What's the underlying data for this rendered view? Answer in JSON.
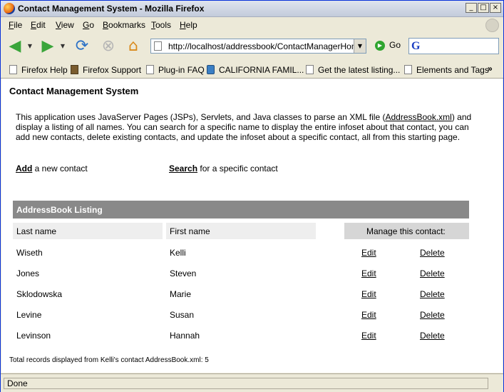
{
  "window": {
    "title": "Contact Management System - Mozilla Firefox",
    "min_label": "_",
    "max_label": "□",
    "close_label": "×"
  },
  "menu": [
    "File",
    "Edit",
    "View",
    "Go",
    "Bookmarks",
    "Tools",
    "Help"
  ],
  "nav": {
    "url": "http://localhost/addressbook/ContactManagerHome.js",
    "go_label": "Go",
    "search_placeholder": ""
  },
  "bookmarks": [
    "Firefox Help",
    "Firefox Support",
    "Plug-in FAQ",
    "CALIFORNIA FAMIL...",
    "Get the latest listing...",
    "Elements and Tags"
  ],
  "bookmarks_overflow": "»",
  "page": {
    "heading": "Contact Management System",
    "intro_before": "This application uses JavaServer Pages (JSPs), Servlets, and Java classes to parse an XML file (",
    "intro_link": "AddressBook.xml",
    "intro_after": ") and display a listing of all names. You can search for a specific name to display the entire infoset about that contact, you can add new contacts, delete existing contacts, and update the infoset about a specific contact, all from this starting page.",
    "add_link": "Add",
    "add_rest": " a new contact",
    "search_link": "Search",
    "search_rest": " for a specific contact",
    "listing_title": "AddressBook Listing",
    "col_last": "Last name",
    "col_first": "First name",
    "col_manage": "Manage this contact:",
    "edit_label": "Edit",
    "delete_label": "Delete",
    "rows": [
      {
        "last": "Wiseth",
        "first": "Kelli"
      },
      {
        "last": "Jones",
        "first": "Steven"
      },
      {
        "last": "Sklodowska",
        "first": "Marie"
      },
      {
        "last": "Levine",
        "first": "Susan"
      },
      {
        "last": "Levinson",
        "first": "Hannah"
      }
    ],
    "footer": "Total records displayed from Kelli's contact AddressBook.xml: 5"
  },
  "status": {
    "text": "Done"
  }
}
